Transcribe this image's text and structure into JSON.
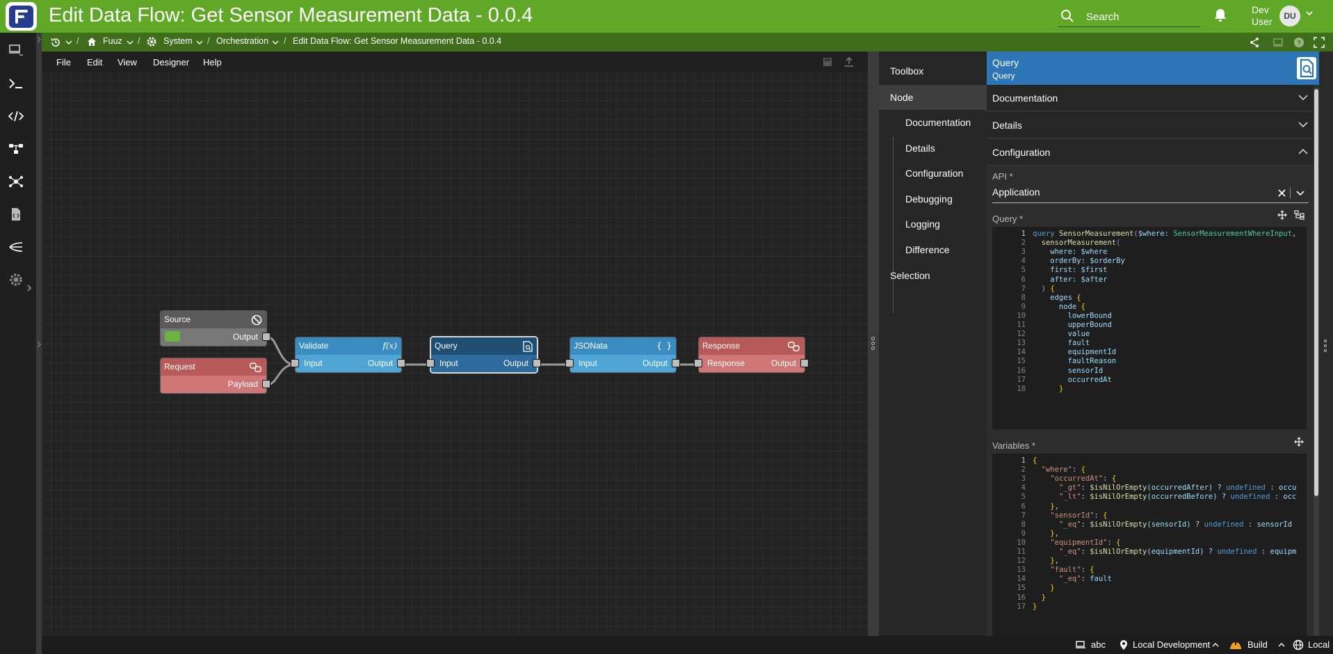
{
  "app": {
    "title": "Edit Data Flow: Get Sensor Measurement Data - 0.0.4"
  },
  "header": {
    "search_placeholder": "Search",
    "user_first": "Dev",
    "user_last": "User",
    "avatar_initials": "DU"
  },
  "breadcrumb": [
    {
      "label": "Fuuz",
      "icon": "home-icon"
    },
    {
      "label": "System",
      "icon": "gear-icon"
    },
    {
      "label": "Orchestration"
    },
    {
      "label": "Edit Data Flow: Get Sensor Measurement Data - 0.0.4"
    }
  ],
  "menu": [
    "File",
    "Edit",
    "View",
    "Designer",
    "Help"
  ],
  "nodes": {
    "source": {
      "title": "Source",
      "out": "Output"
    },
    "request": {
      "title": "Request",
      "out": "Payload"
    },
    "validate": {
      "title": "Validate",
      "in": "Input",
      "out": "Output"
    },
    "query": {
      "title": "Query",
      "in": "Input",
      "out": "Output"
    },
    "jsonata": {
      "title": "JSONata",
      "in": "Input",
      "out": "Output"
    },
    "response": {
      "title": "Response",
      "in": "Response",
      "out": "Output"
    }
  },
  "right_nav": {
    "toolbox": "Toolbox",
    "node": "Node",
    "subs": [
      "Documentation",
      "Details",
      "Configuration",
      "Debugging",
      "Logging",
      "Difference"
    ],
    "selection": "Selection"
  },
  "panel": {
    "title": "Query",
    "subtitle": "Query",
    "sections": [
      "Documentation",
      "Details",
      "Configuration"
    ],
    "api_label": "API *",
    "api_value": "Application",
    "query_label": "Query *",
    "variables_label": "Variables *"
  },
  "query_code": [
    "query SensorMeasurement($where: SensorMeasurementWhereInput,",
    "  sensorMeasurement(",
    "    where: $where",
    "    orderBy: $orderBy",
    "    first: $first",
    "    after: $after",
    "  ) {",
    "    edges {",
    "      node {",
    "        lowerBound",
    "        upperBound",
    "        value",
    "        fault",
    "        equipmentId",
    "        faultReason",
    "        sensorId",
    "        occurredAt",
    "      }"
  ],
  "variables_code": [
    "{",
    "  \"where\": {",
    "    \"occurredAt\": {",
    "      \"_gt\": $isNilOrEmpty(occurredAfter) ? undefined : occu",
    "      \"_lt\": $isNilOrEmpty(occurredBefore) ? undefined : occ",
    "    },",
    "    \"sensorId\": {",
    "      \"_eq\": $isNilOrEmpty(sensorId) ? undefined : sensorId",
    "    },",
    "    \"equipmentId\": {",
    "      \"_eq\": $isNilOrEmpty(equipmentId) ? undefined : equipm",
    "    },",
    "    \"fault\": {",
    "      \"_eq\": fault",
    "    }",
    "  }",
    "}"
  ],
  "status": {
    "project": "abc",
    "environment": "Local Development",
    "build": "Build",
    "locale": "Local"
  },
  "colors": {
    "header": "#61a829",
    "breadcrumb": "#3f6d1b",
    "accent": "#2e75b6",
    "validate": "#3f93c4",
    "query": "#24577f",
    "source": "#555555",
    "request": "#c06060"
  }
}
